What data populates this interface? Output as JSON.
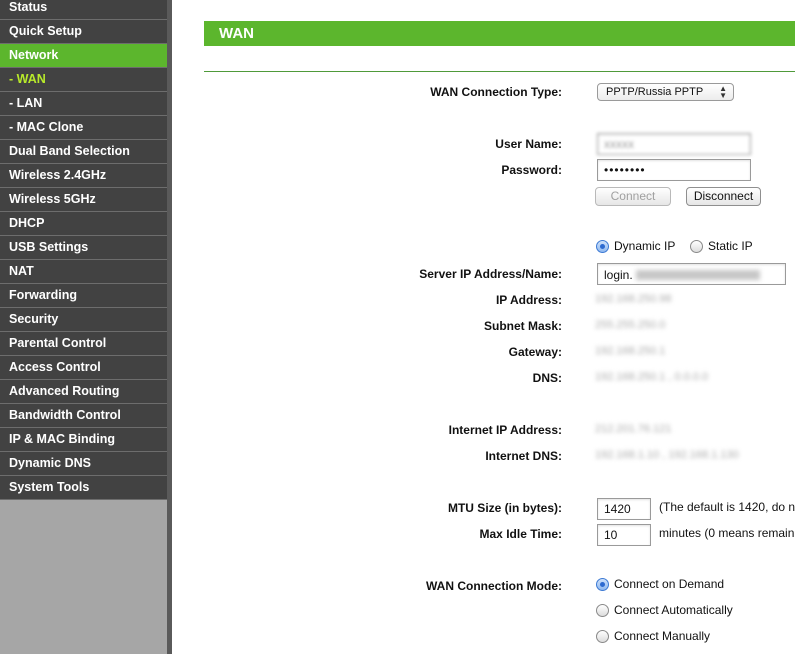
{
  "sidebar": {
    "items": [
      {
        "label": "Status",
        "state": "normal"
      },
      {
        "label": "Quick Setup",
        "state": "normal"
      },
      {
        "label": "Network",
        "state": "active"
      },
      {
        "label": "- WAN",
        "state": "sub-active"
      },
      {
        "label": "- LAN",
        "state": "normal"
      },
      {
        "label": "- MAC Clone",
        "state": "normal"
      },
      {
        "label": "Dual Band Selection",
        "state": "normal"
      },
      {
        "label": "Wireless 2.4GHz",
        "state": "normal"
      },
      {
        "label": "Wireless 5GHz",
        "state": "normal"
      },
      {
        "label": "DHCP",
        "state": "normal"
      },
      {
        "label": "USB Settings",
        "state": "normal"
      },
      {
        "label": "NAT",
        "state": "normal"
      },
      {
        "label": "Forwarding",
        "state": "normal"
      },
      {
        "label": "Security",
        "state": "normal"
      },
      {
        "label": "Parental Control",
        "state": "normal"
      },
      {
        "label": "Access Control",
        "state": "normal"
      },
      {
        "label": "Advanced Routing",
        "state": "normal"
      },
      {
        "label": "Bandwidth Control",
        "state": "normal"
      },
      {
        "label": "IP & MAC Binding",
        "state": "normal"
      },
      {
        "label": "Dynamic DNS",
        "state": "normal"
      },
      {
        "label": "System Tools",
        "state": "normal"
      }
    ]
  },
  "page": {
    "title": "WAN"
  },
  "form": {
    "connection_type_label": "WAN Connection Type:",
    "connection_type_value": "PPTP/Russia PPTP",
    "username_label": "User Name:",
    "username_value": "xxxxx",
    "password_label": "Password:",
    "password_value": "••••••••",
    "connect_label": "Connect",
    "disconnect_label": "Disconnect",
    "dynamic_ip_label": "Dynamic IP",
    "static_ip_label": "Static IP",
    "server_label": "Server IP Address/Name:",
    "server_value": "login.",
    "ip_label": "IP Address:",
    "ip_value": "192.168.250.98",
    "subnet_label": "Subnet Mask:",
    "subnet_value": "255.255.250.0",
    "gateway_label": "Gateway:",
    "gateway_value": "192.168.250.1",
    "dns_label": "DNS:",
    "dns_value": "192.168.250.1 , 0.0.0.0",
    "internet_ip_label": "Internet IP Address:",
    "internet_ip_value": "212.201.76.121",
    "internet_dns_label": "Internet DNS:",
    "internet_dns_value": "192.168.1.10 , 192.168.1.130",
    "mtu_label": "MTU Size (in bytes):",
    "mtu_value": "1420",
    "mtu_note": "(The default is 1420, do n",
    "idle_label": "Max Idle Time:",
    "idle_value": "10",
    "idle_note": "minutes (0 means remain",
    "mode_label": "WAN Connection Mode:",
    "mode_demand": "Connect on Demand",
    "mode_auto": "Connect Automatically",
    "mode_manual": "Connect Manually"
  },
  "colors": {
    "accent_green": "#5cb62d",
    "menu_bg": "#424242",
    "sub_active_text": "#b8ea2a"
  }
}
